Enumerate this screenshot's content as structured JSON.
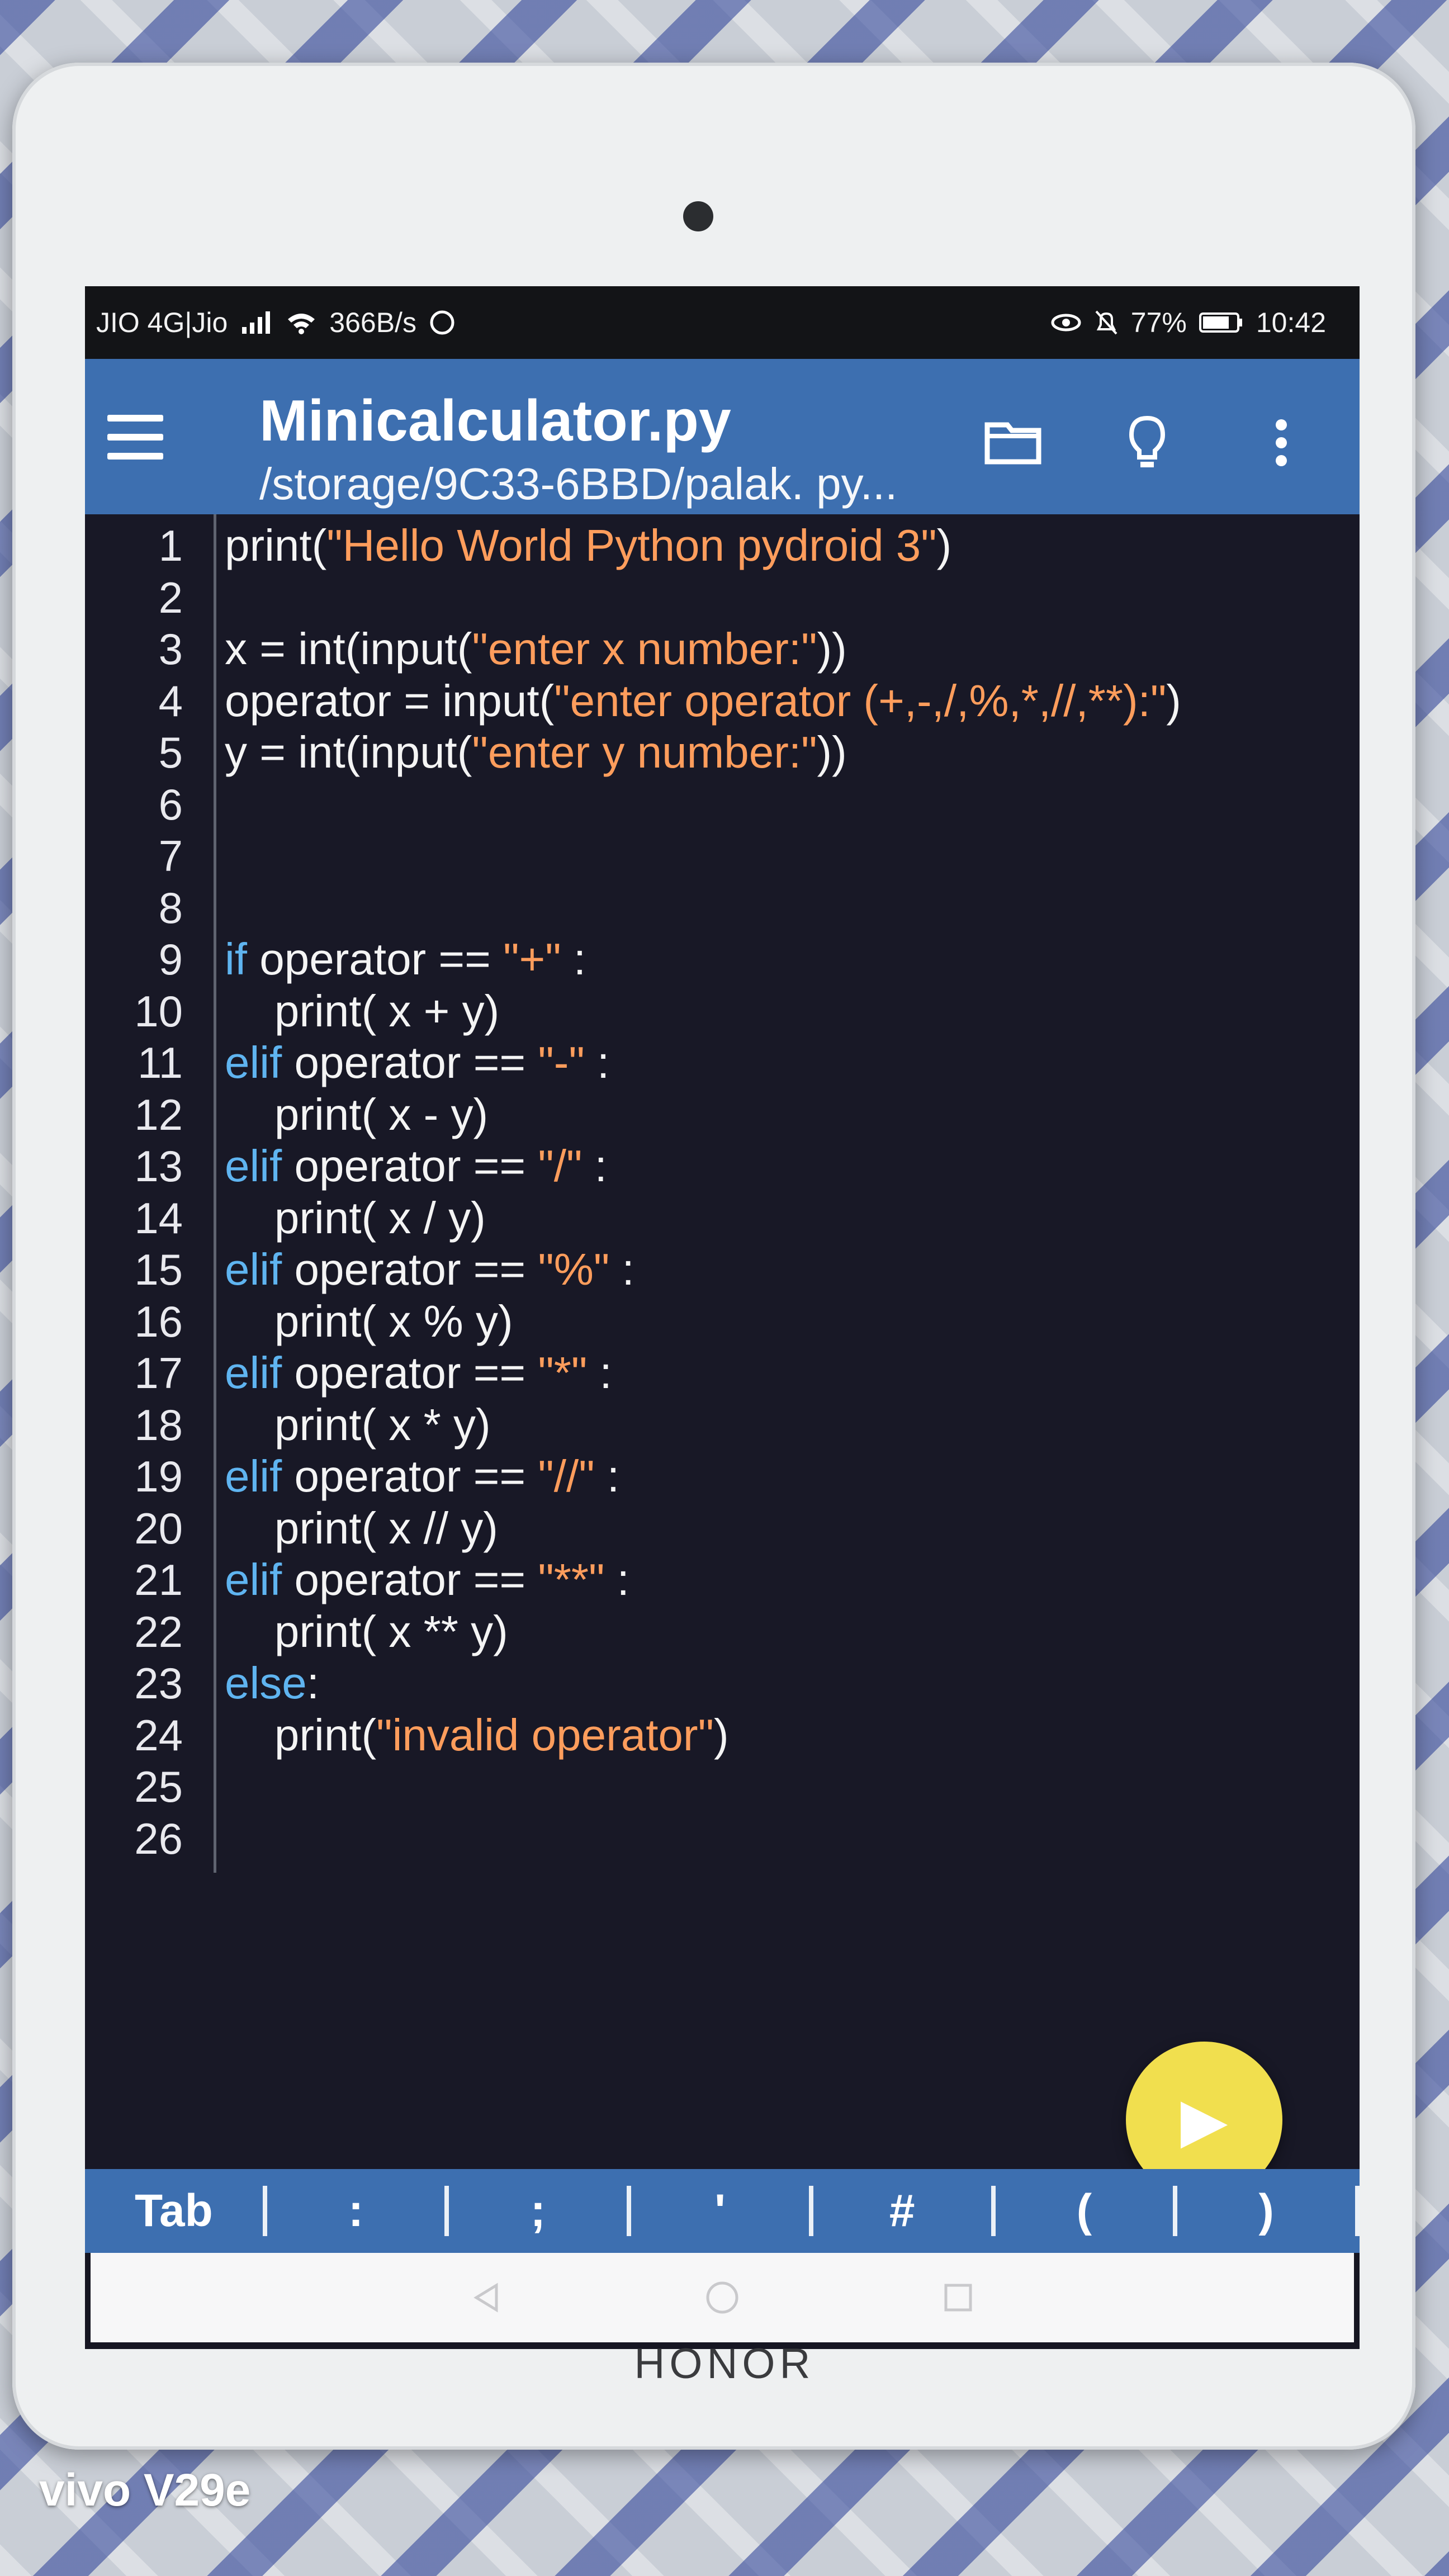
{
  "status_bar": {
    "carrier": "JIO 4G|Jio",
    "speed": "366B/s",
    "battery": "77%",
    "time": "10:42"
  },
  "app_bar": {
    "title": "Minicalculator.py",
    "path": "/storage/9C33-6BBD/palak. py..."
  },
  "editor": {
    "lines": [
      {
        "n": "1",
        "tokens": [
          {
            "t": "print(",
            "c": "plain"
          },
          {
            "t": "\"Hello World Python pydroid 3\"",
            "c": "str"
          },
          {
            "t": ")",
            "c": "plain"
          }
        ]
      },
      {
        "n": "2",
        "tokens": []
      },
      {
        "n": "3",
        "tokens": [
          {
            "t": "x = int(input(",
            "c": "plain"
          },
          {
            "t": "\"enter x number:\"",
            "c": "str"
          },
          {
            "t": "))",
            "c": "plain"
          }
        ]
      },
      {
        "n": "4",
        "tokens": [
          {
            "t": "operator = input(",
            "c": "plain"
          },
          {
            "t": "\"enter operator (+,-,/,%,*,//,**):\"",
            "c": "str"
          },
          {
            "t": ")",
            "c": "plain"
          }
        ]
      },
      {
        "n": "5",
        "tokens": [
          {
            "t": "y = int(input(",
            "c": "plain"
          },
          {
            "t": "\"enter y number:\"",
            "c": "str"
          },
          {
            "t": "))",
            "c": "plain"
          }
        ]
      },
      {
        "n": "6",
        "tokens": []
      },
      {
        "n": "7",
        "tokens": []
      },
      {
        "n": "8",
        "tokens": []
      },
      {
        "n": "9",
        "tokens": [
          {
            "t": "if",
            "c": "kw"
          },
          {
            "t": " operator == ",
            "c": "plain"
          },
          {
            "t": "\"+\"",
            "c": "str"
          },
          {
            "t": " :",
            "c": "plain"
          }
        ]
      },
      {
        "n": "10",
        "tokens": [
          {
            "t": "    print( x + y)",
            "c": "plain"
          }
        ]
      },
      {
        "n": "11",
        "tokens": [
          {
            "t": "elif",
            "c": "kw"
          },
          {
            "t": " operator == ",
            "c": "plain"
          },
          {
            "t": "\"-\"",
            "c": "str"
          },
          {
            "t": " :",
            "c": "plain"
          }
        ]
      },
      {
        "n": "12",
        "tokens": [
          {
            "t": "    print( x - y)",
            "c": "plain"
          }
        ]
      },
      {
        "n": "13",
        "tokens": [
          {
            "t": "elif",
            "c": "kw"
          },
          {
            "t": " operator == ",
            "c": "plain"
          },
          {
            "t": "\"/\"",
            "c": "str"
          },
          {
            "t": " :",
            "c": "plain"
          }
        ]
      },
      {
        "n": "14",
        "tokens": [
          {
            "t": "    print( x / y)",
            "c": "plain"
          }
        ]
      },
      {
        "n": "15",
        "tokens": [
          {
            "t": "elif",
            "c": "kw"
          },
          {
            "t": " operator == ",
            "c": "plain"
          },
          {
            "t": "\"%\"",
            "c": "str"
          },
          {
            "t": " :",
            "c": "plain"
          }
        ]
      },
      {
        "n": "16",
        "tokens": [
          {
            "t": "    print( x % y)",
            "c": "plain"
          }
        ]
      },
      {
        "n": "17",
        "tokens": [
          {
            "t": "elif",
            "c": "kw"
          },
          {
            "t": " operator == ",
            "c": "plain"
          },
          {
            "t": "\"*\"",
            "c": "str"
          },
          {
            "t": " :",
            "c": "plain"
          }
        ]
      },
      {
        "n": "18",
        "tokens": [
          {
            "t": "    print( x * y)",
            "c": "plain"
          }
        ]
      },
      {
        "n": "19",
        "tokens": [
          {
            "t": "elif",
            "c": "kw"
          },
          {
            "t": " operator == ",
            "c": "plain"
          },
          {
            "t": "\"//\"",
            "c": "str"
          },
          {
            "t": " :",
            "c": "plain"
          }
        ]
      },
      {
        "n": "20",
        "tokens": [
          {
            "t": "    print( x // y)",
            "c": "plain"
          }
        ]
      },
      {
        "n": "21",
        "tokens": [
          {
            "t": "elif",
            "c": "kw"
          },
          {
            "t": " operator == ",
            "c": "plain"
          },
          {
            "t": "\"**\"",
            "c": "str"
          },
          {
            "t": " :",
            "c": "plain"
          }
        ]
      },
      {
        "n": "22",
        "tokens": [
          {
            "t": "    print( x ** y)",
            "c": "plain"
          }
        ]
      },
      {
        "n": "23",
        "tokens": [
          {
            "t": "else",
            "c": "kw"
          },
          {
            "t": ":",
            "c": "plain"
          }
        ]
      },
      {
        "n": "24",
        "tokens": [
          {
            "t": "    print(",
            "c": "plain"
          },
          {
            "t": "\"invalid operator\"",
            "c": "str"
          },
          {
            "t": ")",
            "c": "plain"
          }
        ]
      },
      {
        "n": "25",
        "tokens": []
      },
      {
        "n": "26",
        "tokens": []
      }
    ]
  },
  "key_bar": {
    "keys": [
      "Tab",
      ":",
      ";",
      "'",
      "#",
      "(",
      ")"
    ]
  },
  "device": {
    "brand": "HONOR",
    "watermark": "vivo V29e"
  },
  "colors": {
    "accent": "#3d6fb0",
    "editor_bg": "#181826",
    "string": "#ff9d5c",
    "keyword": "#5fb4f0",
    "fab": "#f1df4e"
  },
  "icons": [
    "menu-icon",
    "folder-icon",
    "bulb-icon",
    "more-vert-icon",
    "signal-icon",
    "wifi-icon",
    "whatsapp-icon",
    "eye-icon",
    "mute-icon",
    "battery-icon",
    "run-icon",
    "back-icon",
    "home-icon",
    "recents-icon"
  ]
}
